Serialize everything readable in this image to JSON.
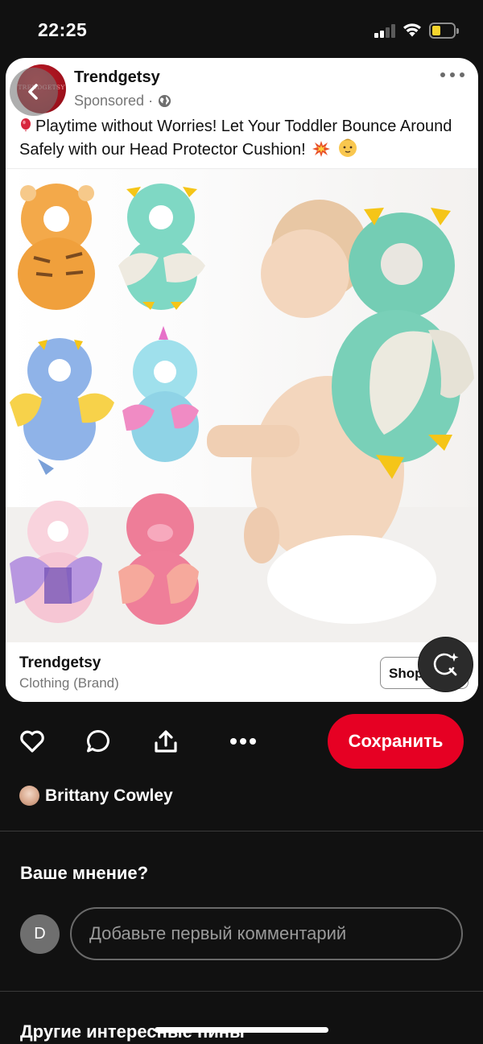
{
  "status_bar": {
    "time": "22:25",
    "signal_icon": "cellular-signal-icon",
    "wifi_icon": "wifi-icon",
    "battery_icon": "battery-low-icon",
    "battery_level": 0.15,
    "battery_color": "#f6d42c"
  },
  "pin": {
    "advertiser": {
      "name": "Trendgetsy",
      "avatar_text": "TRENDGETSY",
      "sponsored": "Sponsored ·",
      "globe_icon": "globe-icon",
      "brand_color": "#b3121f"
    },
    "description": "Playtime without Worries! Let Your Toddler Bounce Around Safely with our Head Protector Cushion!",
    "description_icons": [
      "balloon-icon",
      "collision-icon",
      "baby-face-icon"
    ],
    "footer": {
      "brand": "Trendgetsy",
      "category": "Clothing (Brand)",
      "shop_label": "Shop now"
    }
  },
  "actions": {
    "like_icon": "heart-icon",
    "comment_icon": "comment-icon",
    "share_icon": "share-icon",
    "more_icon": "more-icon",
    "save_label": "Сохранить",
    "save_color": "#e60023"
  },
  "saver": {
    "name": "Brittany Cowley"
  },
  "comments": {
    "title": "Ваше мнение?",
    "user_initial": "D",
    "placeholder": "Добавьте первый комментарий"
  },
  "more_pins": {
    "title": "Другие интересные пины"
  }
}
